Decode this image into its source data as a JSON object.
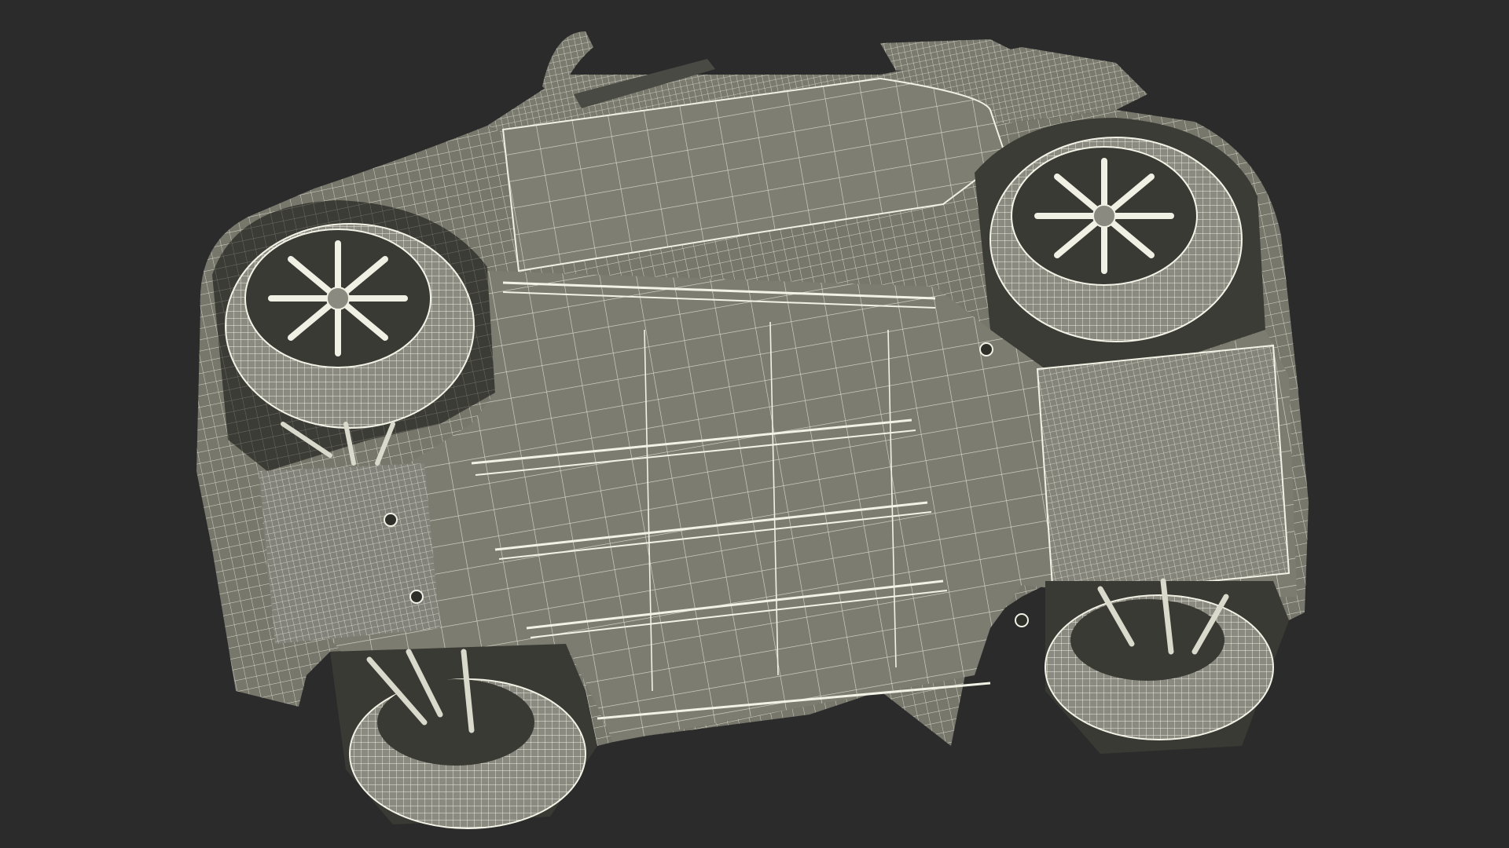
{
  "scene": {
    "subject_icon": "car-underside-wireframe-icon",
    "colors": {
      "background": "#2b2b2b",
      "surface": "#77776c",
      "surface_dark": "#5f5f56",
      "surface_light": "#8a8a7e",
      "wire": "#e9e9dc",
      "shadow": "#3a3a35"
    }
  }
}
